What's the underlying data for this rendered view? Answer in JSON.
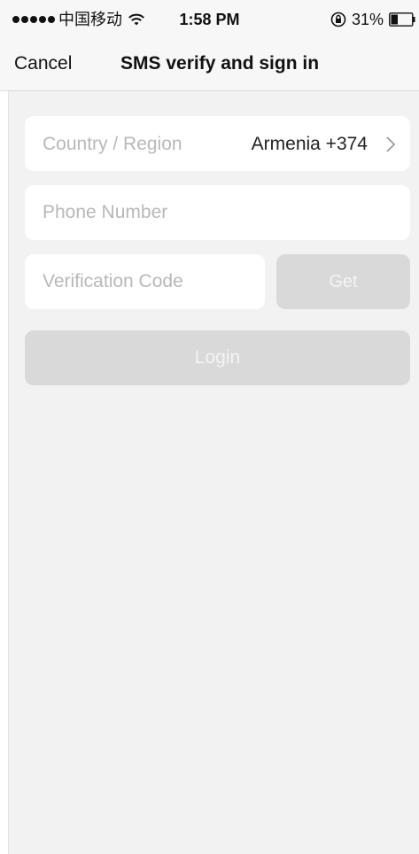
{
  "status_bar": {
    "carrier": "中国移动",
    "time": "1:58 PM",
    "battery": "31%",
    "icons": {
      "signal": "signal-dots-icon",
      "wifi": "wifi-icon",
      "orientation_lock": "rotation-lock-icon",
      "battery": "battery-icon"
    }
  },
  "nav": {
    "cancel_label": "Cancel",
    "title": "SMS verify and sign in"
  },
  "form": {
    "country": {
      "label": "Country / Region",
      "value": "Armenia +374",
      "icon": "chevron-right-icon"
    },
    "phone": {
      "placeholder": "Phone Number",
      "value": ""
    },
    "code": {
      "placeholder": "Verification Code",
      "value": ""
    },
    "get_label": "Get",
    "login_label": "Login"
  },
  "colors": {
    "background": "#f2f2f2",
    "field": "#ffffff",
    "placeholder": "#b8b8b8",
    "disabled_button": "#d9d9d9"
  }
}
